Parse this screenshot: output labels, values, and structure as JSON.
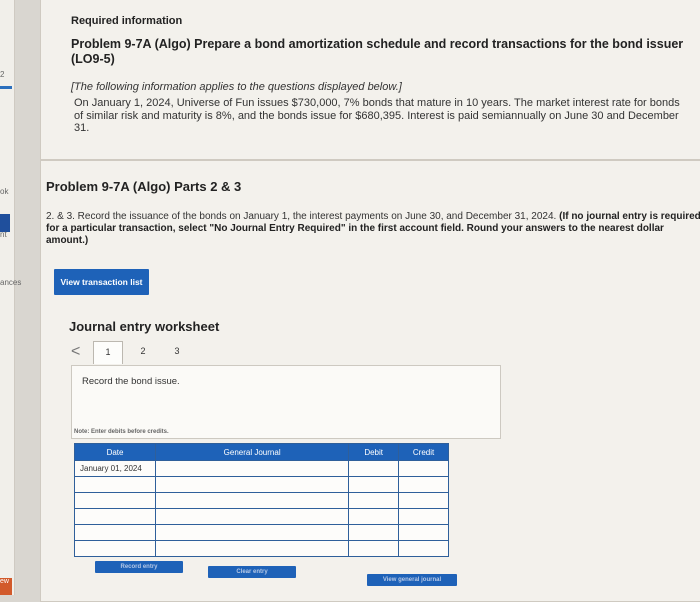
{
  "rail": {
    "labels": [
      "2",
      "ok",
      "nt",
      "ances",
      "ew"
    ]
  },
  "info": {
    "heading": "Required information",
    "problem_title": "Problem 9-7A (Algo) Prepare a bond amortization schedule and record transactions for the bond issuer (LO9-5)",
    "note": "[The following information applies to the questions displayed below.]",
    "body": "On January 1, 2024, Universe of Fun issues $730,000, 7% bonds that mature in 10 years. The market interest rate for bonds of similar risk and maturity is 8%, and the bonds issue for $680,395. Interest is paid semiannually on June 30 and December 31."
  },
  "parts": {
    "title": "Problem 9-7A (Algo) Parts 2 & 3",
    "instruction_plain": "2. & 3. Record the issuance of the bonds on January 1, the interest payments on June 30, and December 31, 2024.",
    "instruction_bold": "(If no journal entry is required for a particular transaction, select \"No Journal Entry Required\" in the first account field. Round your answers to the nearest dollar amount.)",
    "view_transactions_label": "View transaction list"
  },
  "worksheet": {
    "title": "Journal entry worksheet",
    "tabs": [
      "1",
      "2",
      "3"
    ],
    "active_tab": "1",
    "prev_arrow": "<",
    "next_arrow": ">",
    "instruction": "Record the bond issue.",
    "note": "Note: Enter debits before credits.",
    "columns": [
      "Date",
      "General Journal",
      "Debit",
      "Credit"
    ],
    "date_value": "January 01, 2024",
    "row_count": 6,
    "record_label": "Record entry",
    "clear_label": "Clear entry",
    "view_general_label": "View general journal"
  },
  "colors": {
    "accent": "#1e62b8",
    "panel": "#f3f1ec",
    "background": "#d9d6d0"
  }
}
